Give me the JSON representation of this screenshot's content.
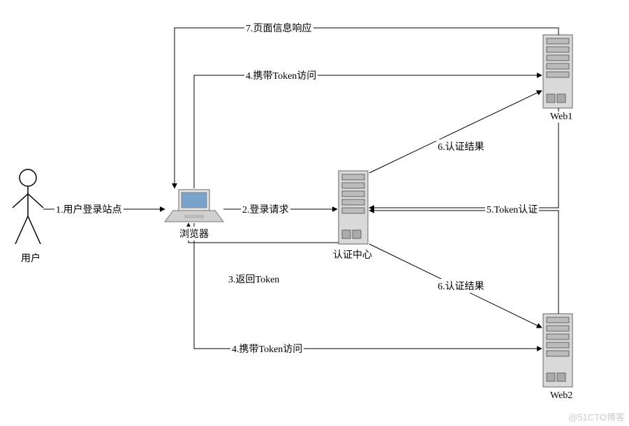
{
  "nodes": {
    "user": "用户",
    "browser": "浏览器",
    "authcenter": "认证中心",
    "web1": "Web1",
    "web2": "Web2"
  },
  "edges": {
    "s1": "1.用户登录站点",
    "s2": "2.登录请求",
    "s3": "3.返回Token",
    "s4a": "4.携带Token访问",
    "s4b": "4.携带Token访问",
    "s5": "5.Token认证",
    "s6a": "6.认证结果",
    "s6b": "6.认证结果",
    "s7": "7.页面信息响应"
  },
  "watermark": "@51CTO博客"
}
